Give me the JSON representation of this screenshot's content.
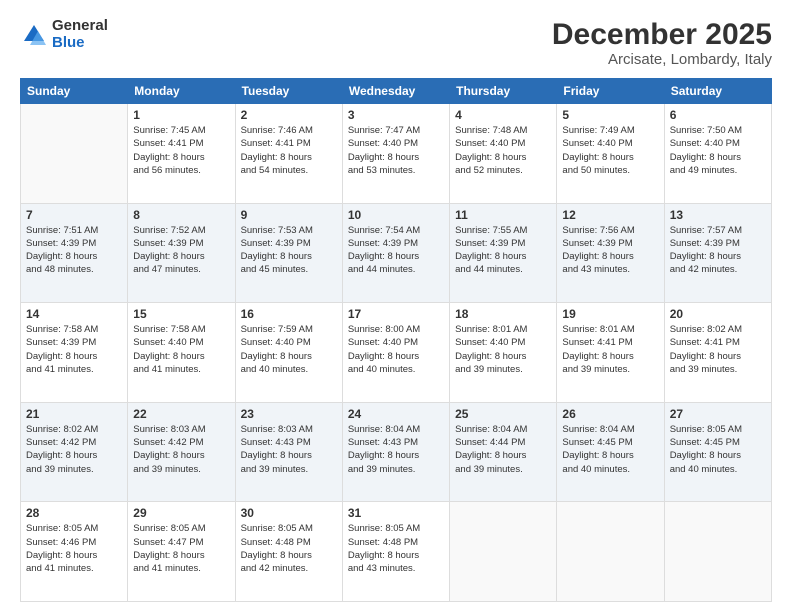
{
  "header": {
    "logo_general": "General",
    "logo_blue": "Blue",
    "title": "December 2025",
    "subtitle": "Arcisate, Lombardy, Italy"
  },
  "days_of_week": [
    "Sunday",
    "Monday",
    "Tuesday",
    "Wednesday",
    "Thursday",
    "Friday",
    "Saturday"
  ],
  "weeks": [
    [
      {
        "day": "",
        "info": ""
      },
      {
        "day": "1",
        "info": "Sunrise: 7:45 AM\nSunset: 4:41 PM\nDaylight: 8 hours\nand 56 minutes."
      },
      {
        "day": "2",
        "info": "Sunrise: 7:46 AM\nSunset: 4:41 PM\nDaylight: 8 hours\nand 54 minutes."
      },
      {
        "day": "3",
        "info": "Sunrise: 7:47 AM\nSunset: 4:40 PM\nDaylight: 8 hours\nand 53 minutes."
      },
      {
        "day": "4",
        "info": "Sunrise: 7:48 AM\nSunset: 4:40 PM\nDaylight: 8 hours\nand 52 minutes."
      },
      {
        "day": "5",
        "info": "Sunrise: 7:49 AM\nSunset: 4:40 PM\nDaylight: 8 hours\nand 50 minutes."
      },
      {
        "day": "6",
        "info": "Sunrise: 7:50 AM\nSunset: 4:40 PM\nDaylight: 8 hours\nand 49 minutes."
      }
    ],
    [
      {
        "day": "7",
        "info": "Sunrise: 7:51 AM\nSunset: 4:39 PM\nDaylight: 8 hours\nand 48 minutes."
      },
      {
        "day": "8",
        "info": "Sunrise: 7:52 AM\nSunset: 4:39 PM\nDaylight: 8 hours\nand 47 minutes."
      },
      {
        "day": "9",
        "info": "Sunrise: 7:53 AM\nSunset: 4:39 PM\nDaylight: 8 hours\nand 45 minutes."
      },
      {
        "day": "10",
        "info": "Sunrise: 7:54 AM\nSunset: 4:39 PM\nDaylight: 8 hours\nand 44 minutes."
      },
      {
        "day": "11",
        "info": "Sunrise: 7:55 AM\nSunset: 4:39 PM\nDaylight: 8 hours\nand 44 minutes."
      },
      {
        "day": "12",
        "info": "Sunrise: 7:56 AM\nSunset: 4:39 PM\nDaylight: 8 hours\nand 43 minutes."
      },
      {
        "day": "13",
        "info": "Sunrise: 7:57 AM\nSunset: 4:39 PM\nDaylight: 8 hours\nand 42 minutes."
      }
    ],
    [
      {
        "day": "14",
        "info": "Sunrise: 7:58 AM\nSunset: 4:39 PM\nDaylight: 8 hours\nand 41 minutes."
      },
      {
        "day": "15",
        "info": "Sunrise: 7:58 AM\nSunset: 4:40 PM\nDaylight: 8 hours\nand 41 minutes."
      },
      {
        "day": "16",
        "info": "Sunrise: 7:59 AM\nSunset: 4:40 PM\nDaylight: 8 hours\nand 40 minutes."
      },
      {
        "day": "17",
        "info": "Sunrise: 8:00 AM\nSunset: 4:40 PM\nDaylight: 8 hours\nand 40 minutes."
      },
      {
        "day": "18",
        "info": "Sunrise: 8:01 AM\nSunset: 4:40 PM\nDaylight: 8 hours\nand 39 minutes."
      },
      {
        "day": "19",
        "info": "Sunrise: 8:01 AM\nSunset: 4:41 PM\nDaylight: 8 hours\nand 39 minutes."
      },
      {
        "day": "20",
        "info": "Sunrise: 8:02 AM\nSunset: 4:41 PM\nDaylight: 8 hours\nand 39 minutes."
      }
    ],
    [
      {
        "day": "21",
        "info": "Sunrise: 8:02 AM\nSunset: 4:42 PM\nDaylight: 8 hours\nand 39 minutes."
      },
      {
        "day": "22",
        "info": "Sunrise: 8:03 AM\nSunset: 4:42 PM\nDaylight: 8 hours\nand 39 minutes."
      },
      {
        "day": "23",
        "info": "Sunrise: 8:03 AM\nSunset: 4:43 PM\nDaylight: 8 hours\nand 39 minutes."
      },
      {
        "day": "24",
        "info": "Sunrise: 8:04 AM\nSunset: 4:43 PM\nDaylight: 8 hours\nand 39 minutes."
      },
      {
        "day": "25",
        "info": "Sunrise: 8:04 AM\nSunset: 4:44 PM\nDaylight: 8 hours\nand 39 minutes."
      },
      {
        "day": "26",
        "info": "Sunrise: 8:04 AM\nSunset: 4:45 PM\nDaylight: 8 hours\nand 40 minutes."
      },
      {
        "day": "27",
        "info": "Sunrise: 8:05 AM\nSunset: 4:45 PM\nDaylight: 8 hours\nand 40 minutes."
      }
    ],
    [
      {
        "day": "28",
        "info": "Sunrise: 8:05 AM\nSunset: 4:46 PM\nDaylight: 8 hours\nand 41 minutes."
      },
      {
        "day": "29",
        "info": "Sunrise: 8:05 AM\nSunset: 4:47 PM\nDaylight: 8 hours\nand 41 minutes."
      },
      {
        "day": "30",
        "info": "Sunrise: 8:05 AM\nSunset: 4:48 PM\nDaylight: 8 hours\nand 42 minutes."
      },
      {
        "day": "31",
        "info": "Sunrise: 8:05 AM\nSunset: 4:48 PM\nDaylight: 8 hours\nand 43 minutes."
      },
      {
        "day": "",
        "info": ""
      },
      {
        "day": "",
        "info": ""
      },
      {
        "day": "",
        "info": ""
      }
    ]
  ]
}
